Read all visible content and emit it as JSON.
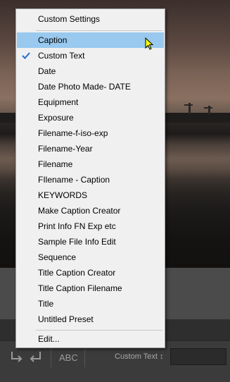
{
  "menu": {
    "header": "Custom Settings",
    "items": [
      {
        "label": "Caption",
        "highlighted": true,
        "checked": false
      },
      {
        "label": "Custom Text",
        "highlighted": false,
        "checked": true
      },
      {
        "label": "Date",
        "highlighted": false,
        "checked": false
      },
      {
        "label": "Date Photo Made- DATE",
        "highlighted": false,
        "checked": false
      },
      {
        "label": "Equipment",
        "highlighted": false,
        "checked": false
      },
      {
        "label": "Exposure",
        "highlighted": false,
        "checked": false
      },
      {
        "label": "Filename-f-iso-exp",
        "highlighted": false,
        "checked": false
      },
      {
        "label": "Filename-Year",
        "highlighted": false,
        "checked": false
      },
      {
        "label": "Filename",
        "highlighted": false,
        "checked": false
      },
      {
        "label": "FIlename - Caption",
        "highlighted": false,
        "checked": false
      },
      {
        "label": "KEYWORDS",
        "highlighted": false,
        "checked": false
      },
      {
        "label": "Make Caption Creator",
        "highlighted": false,
        "checked": false
      },
      {
        "label": "Print Info FN Exp etc",
        "highlighted": false,
        "checked": false
      },
      {
        "label": "Sample File Info Edit",
        "highlighted": false,
        "checked": false
      },
      {
        "label": "Sequence",
        "highlighted": false,
        "checked": false
      },
      {
        "label": "Title Caption Creator",
        "highlighted": false,
        "checked": false
      },
      {
        "label": "Title Caption Filename",
        "highlighted": false,
        "checked": false
      },
      {
        "label": "Title",
        "highlighted": false,
        "checked": false
      },
      {
        "label": "Untitled Preset",
        "highlighted": false,
        "checked": false
      }
    ],
    "edit": "Edit..."
  },
  "toolbar": {
    "abc_label": "ABC",
    "preset_label": "Custom Text ↕"
  },
  "colors": {
    "highlight": "#99c9ef",
    "check": "#1f6fd0"
  }
}
